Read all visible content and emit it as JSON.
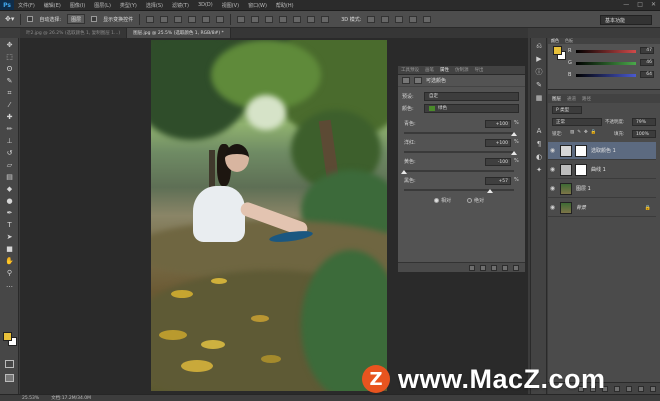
{
  "app": {
    "logo": "Ps"
  },
  "menu": [
    "文件(F)",
    "编辑(E)",
    "图像(I)",
    "图层(L)",
    "类型(Y)",
    "选择(S)",
    "滤镜(T)",
    "3D(D)",
    "视图(V)",
    "窗口(W)",
    "帮助(H)"
  ],
  "options_bar": {
    "auto_select_label": "自动选择:",
    "auto_select_value": "图层",
    "show_transform_label": "显示变换控件",
    "mode_3d_label": "3D 模式:",
    "workspace": "基本功能"
  },
  "tabs": [
    {
      "label": "叶2.jpg @ 26.2% (选取颜色 1, 复制图层 1...)",
      "active": false
    },
    {
      "label": "图层.jpg @ 25.5% (选取颜色 1, RGB/8#) *",
      "active": true
    }
  ],
  "toolbar_icons": [
    "move-icon",
    "marquee-icon",
    "lasso-icon",
    "quick-select-icon",
    "crop-icon",
    "eyedropper-icon",
    "healing-icon",
    "brush-icon",
    "stamp-icon",
    "history-brush-icon",
    "eraser-icon",
    "gradient-icon",
    "blur-icon",
    "dodge-icon",
    "pen-icon",
    "type-icon",
    "path-select-icon",
    "shape-icon",
    "hand-icon",
    "zoom-icon"
  ],
  "properties": {
    "tabs": [
      "工具预设",
      "画笔",
      "属性",
      "仿制源",
      "导出"
    ],
    "active_tab": "属性",
    "title": "可选颜色",
    "preset_label": "预设:",
    "preset_value": "自定",
    "colors_label": "颜色:",
    "colors_value": "绿色",
    "sliders": [
      {
        "label": "青色:",
        "value": "+100",
        "unit": "%",
        "level": 1.0
      },
      {
        "label": "洋红:",
        "value": "+100",
        "unit": "%",
        "level": 1.0
      },
      {
        "label": "黄色:",
        "value": "-100",
        "unit": "%",
        "level": 0.0
      },
      {
        "label": "黑色:",
        "value": "+57",
        "unit": "%",
        "level": 0.785
      }
    ],
    "method_relative": "相对",
    "method_absolute": "绝对",
    "selected_method": "相对"
  },
  "color_panel": {
    "tabs": [
      "颜色",
      "色板"
    ],
    "channels": [
      {
        "label": "R",
        "value": "47",
        "color": "#d04a4a"
      },
      {
        "label": "G",
        "value": "46",
        "color": "#4aa84a"
      },
      {
        "label": "B",
        "value": "64",
        "color": "#4a5ad0"
      }
    ]
  },
  "layers_panel": {
    "tabs": [
      "图层",
      "通道",
      "路径"
    ],
    "kind_label": "P 类型",
    "blend_mode": "正常",
    "opacity_label": "不透明度:",
    "opacity_value": "79%",
    "lock_label": "锁定:",
    "fill_label": "填充:",
    "fill_value": "100%",
    "layers": [
      {
        "name": "选取颜色 1",
        "selected": true,
        "type": "adjustment"
      },
      {
        "name": "曲线 1",
        "selected": false,
        "type": "adjustment"
      },
      {
        "name": "图层 1",
        "selected": false,
        "type": "image"
      },
      {
        "name": "背景",
        "selected": false,
        "type": "image",
        "locked": true
      }
    ]
  },
  "status": {
    "zoom": "25.53%",
    "doc": "文档:17.2M/34.0M"
  },
  "watermark": {
    "text": "www.MacZ.com",
    "logo": "Z"
  },
  "colors": {
    "selection": "#5c6a80",
    "foreground": "#e9c13a",
    "accent_brand": "#e8541f"
  }
}
